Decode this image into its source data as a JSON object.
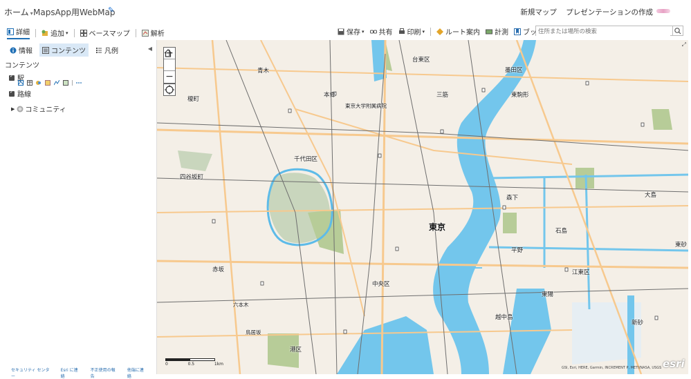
{
  "topbar": {
    "home_label": "ホーム",
    "map_title": "MapsApp用WebMap",
    "new_map": "新規マップ",
    "create_presentation": "プレゼンテーションの作成"
  },
  "toolbar": {
    "details": "詳細",
    "add": "追加",
    "basemap": "ベースマップ",
    "analysis": "解析",
    "save": "保存",
    "share": "共有",
    "print": "印刷",
    "directions": "ルート案内",
    "measure": "計測",
    "bookmarks": "ブックマーク"
  },
  "search": {
    "placeholder": "住所または場所の検索"
  },
  "panel": {
    "tabs": {
      "about": "情報",
      "content": "コンテンツ",
      "legend": "凡例"
    },
    "section_title": "コンテンツ",
    "layers": [
      {
        "name": "駅",
        "checked": true
      },
      {
        "name": "路線",
        "checked": true
      }
    ],
    "group": "コミュニティ",
    "footer": [
      "セキュリティ センター",
      "Esri に連絡",
      "不正使用の報告",
      "他端に連絡"
    ]
  },
  "map": {
    "zoom_in": "+",
    "zoom_out": "−",
    "scale_labels": [
      "0",
      "0.5",
      "1km"
    ],
    "attribution": "GSI, Esri, HERE, Garmin, INCREMENT P, METI/NASA, USGS",
    "logo": "esri",
    "labels": [
      {
        "text": "東京",
        "cls": "big"
      },
      {
        "text": "千代田区",
        "cls": "mid"
      },
      {
        "text": "台東区",
        "cls": "mid"
      },
      {
        "text": "墨田区",
        "cls": "mid"
      },
      {
        "text": "本郷",
        "cls": "mid"
      },
      {
        "text": "三筋",
        "cls": "mid"
      },
      {
        "text": "東駒形",
        "cls": "mid"
      },
      {
        "text": "青木",
        "cls": "mid"
      },
      {
        "text": "榎町",
        "cls": "mid"
      },
      {
        "text": "四谷坂町",
        "cls": "mid"
      },
      {
        "text": "森下",
        "cls": "mid"
      },
      {
        "text": "大島",
        "cls": "mid"
      },
      {
        "text": "石島",
        "cls": "mid"
      },
      {
        "text": "平野",
        "cls": "mid"
      },
      {
        "text": "東砂",
        "cls": "mid"
      },
      {
        "text": "江東区",
        "cls": "mid"
      },
      {
        "text": "赤坂",
        "cls": "mid"
      },
      {
        "text": "中央区",
        "cls": "mid"
      },
      {
        "text": "東陽",
        "cls": "mid"
      },
      {
        "text": "越中島",
        "cls": "mid"
      },
      {
        "text": "新砂",
        "cls": "mid"
      },
      {
        "text": "港区",
        "cls": "mid"
      },
      {
        "text": "六本木",
        "cls": ""
      },
      {
        "text": "鳥居坂",
        "cls": ""
      },
      {
        "text": "東京大学附属病院",
        "cls": ""
      }
    ]
  }
}
